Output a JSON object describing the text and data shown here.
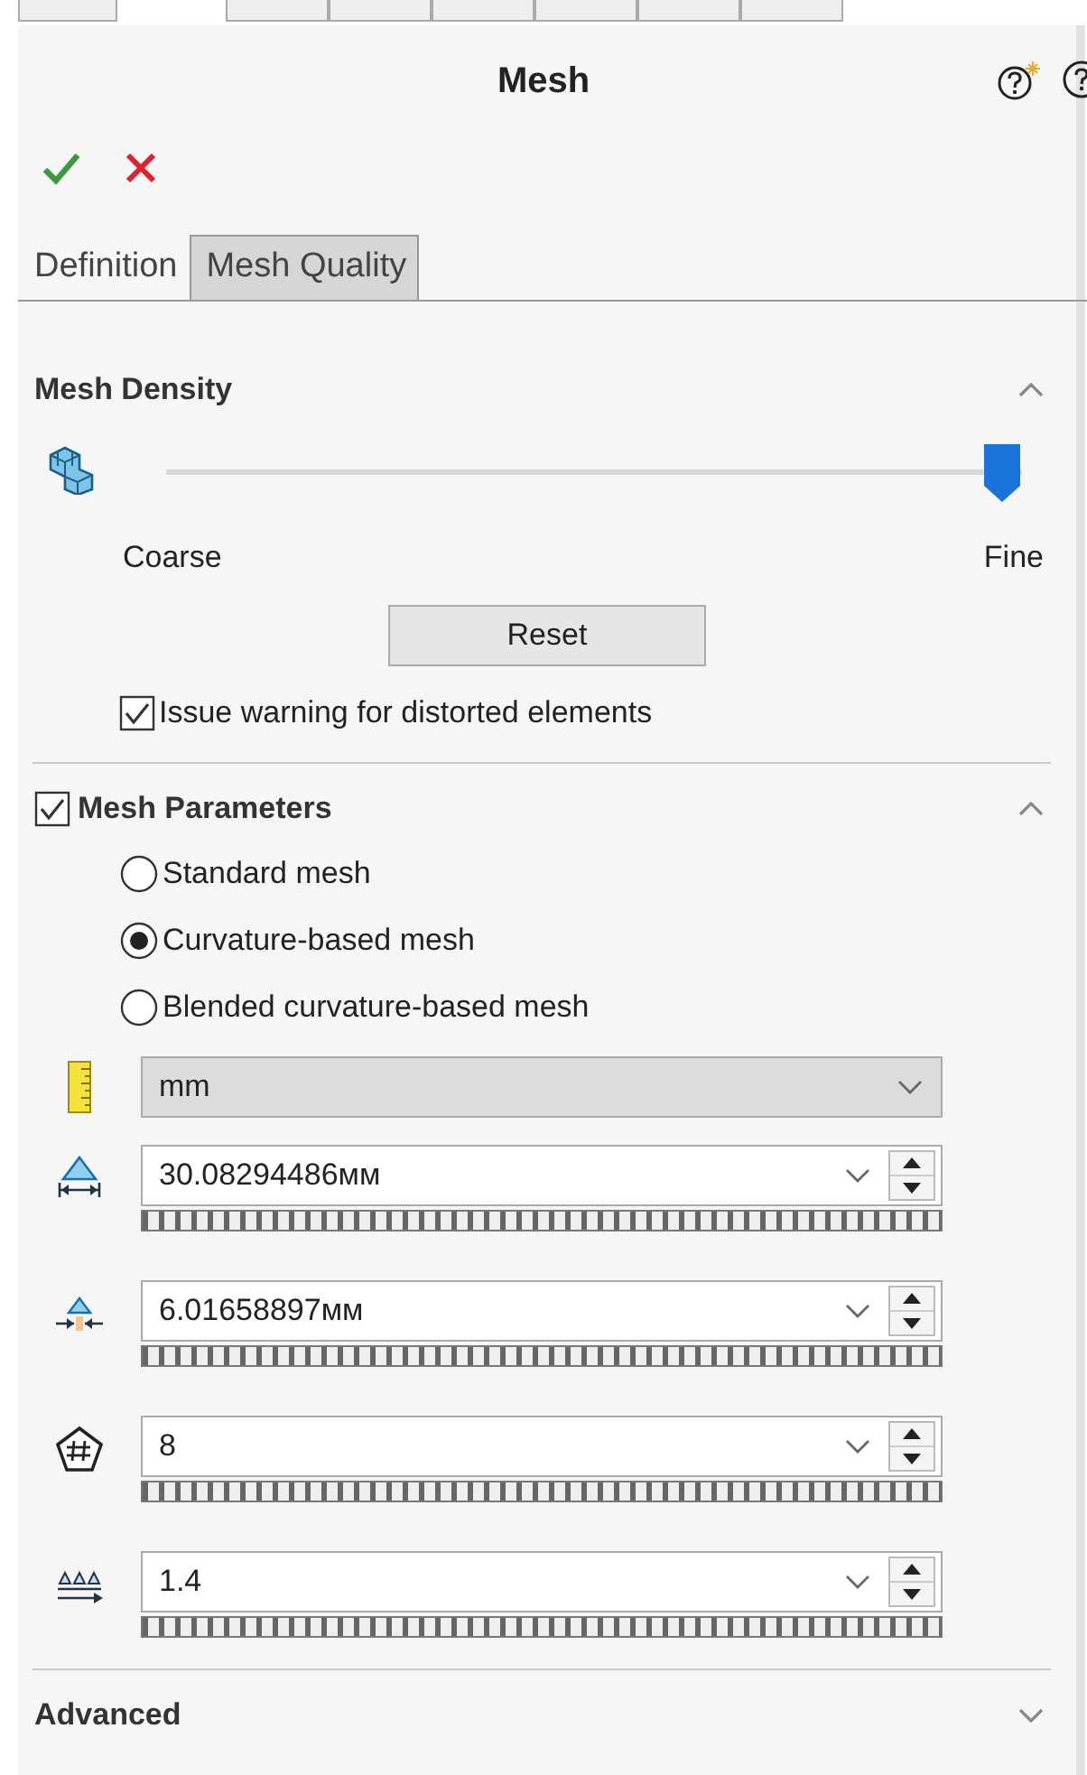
{
  "header": {
    "title": "Mesh"
  },
  "tabs": [
    {
      "label": "Definition",
      "selected": true
    },
    {
      "label": "Mesh Quality",
      "selected": false
    }
  ],
  "mesh_density": {
    "title": "Mesh Density",
    "expanded": true,
    "slider": {
      "level": 1.0
    },
    "min_label": "Coarse",
    "max_label": "Fine",
    "reset_button": "Reset",
    "warning_checkbox": {
      "label": "Issue warning for distorted elements",
      "checked": true
    }
  },
  "mesh_parameters": {
    "title": "Mesh Parameters",
    "checked": true,
    "expanded": true,
    "options": [
      {
        "label": "Standard mesh",
        "selected": false
      },
      {
        "label": "Curvature-based mesh",
        "selected": true
      },
      {
        "label": "Blended curvature-based mesh",
        "selected": false
      }
    ],
    "units": "mm",
    "fields": [
      {
        "kind": "max_size",
        "value": "30.08294486мм"
      },
      {
        "kind": "min_size",
        "value": "6.01658897мм"
      },
      {
        "kind": "count",
        "value": "8"
      },
      {
        "kind": "ratio",
        "value": "1.4"
      }
    ]
  },
  "advanced": {
    "title": "Advanced",
    "expanded": false
  }
}
